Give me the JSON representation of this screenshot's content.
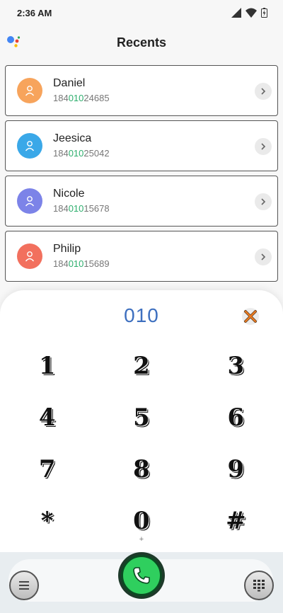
{
  "status_bar": {
    "time": "2:36 AM"
  },
  "header": {
    "title": "Recents"
  },
  "contacts": [
    {
      "name": "Daniel",
      "number_prefix": "184",
      "number_match": "010",
      "number_suffix": "24685",
      "avatar_color": "#f7a45c"
    },
    {
      "name": "Jeesica",
      "number_prefix": "184",
      "number_match": "010",
      "number_suffix": "25042",
      "avatar_color": "#3aa8e8"
    },
    {
      "name": "Nicole",
      "number_prefix": "184",
      "number_match": "010",
      "number_suffix": "15678",
      "avatar_color": "#7c83e8"
    },
    {
      "name": "Philip",
      "number_prefix": "184",
      "number_match": "010",
      "number_suffix": "15689",
      "avatar_color": "#f2705e"
    }
  ],
  "dialer": {
    "input": "010",
    "keys": [
      {
        "label": "1",
        "sub": ""
      },
      {
        "label": "2",
        "sub": ""
      },
      {
        "label": "3",
        "sub": ""
      },
      {
        "label": "4",
        "sub": ""
      },
      {
        "label": "5",
        "sub": ""
      },
      {
        "label": "6",
        "sub": ""
      },
      {
        "label": "7",
        "sub": ""
      },
      {
        "label": "8",
        "sub": ""
      },
      {
        "label": "9",
        "sub": ""
      },
      {
        "label": "*",
        "sub": ""
      },
      {
        "label": "0",
        "sub": "+"
      },
      {
        "label": "#",
        "sub": ""
      }
    ]
  },
  "colors": {
    "highlight": "#2eaf6e",
    "input_text": "#3d6fbf",
    "call_green": "#2fcf5e"
  }
}
